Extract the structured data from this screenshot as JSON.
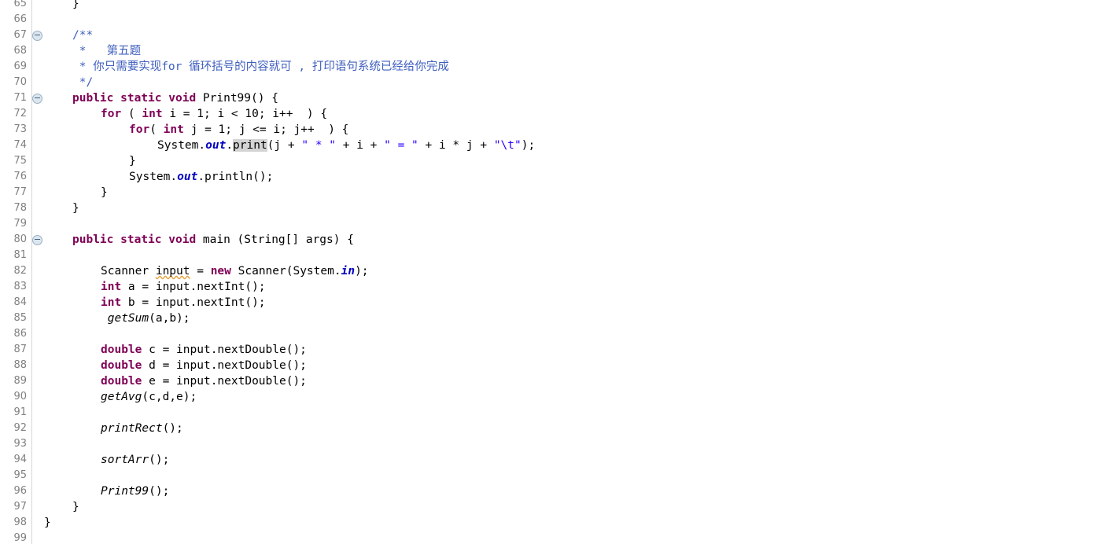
{
  "editor": {
    "kind": "java-source-editor",
    "language": "Java",
    "line_height": 20,
    "first_visible_line": 64,
    "last_visible_line": 99,
    "colors": {
      "background": "#ffffff",
      "keyword": "#7f0055",
      "string": "#2a00ff",
      "comment": "#3f5fbf",
      "javadoc_tag": "#7f9fbf",
      "static_field": "#0000c0",
      "line_number": "#808080",
      "occurrence_highlight": "#d4d4d4",
      "warning_underline": "#e8a33d",
      "warning_marker": "#f5b60d",
      "gutter_separator": "#d6d6d6"
    }
  },
  "gutter": {
    "line_numbers": [
      65,
      66,
      67,
      68,
      69,
      70,
      71,
      72,
      73,
      74,
      75,
      76,
      77,
      78,
      79,
      80,
      81,
      82,
      83,
      84,
      85,
      86,
      87,
      88,
      89,
      90,
      91,
      92,
      93,
      94,
      95,
      96,
      97,
      98
    ],
    "fold_markers": {
      "label": "collapse-fold-icon",
      "lines": [
        67,
        71,
        80
      ]
    },
    "warning_markers": {
      "label": "warning-marker-icon",
      "lines": [
        82
      ]
    }
  },
  "code": {
    "lines": [
      {
        "num": 65,
        "indent": 1,
        "text": "}"
      },
      {
        "num": 66,
        "indent": 0,
        "text": ""
      },
      {
        "num": 67,
        "indent": 1,
        "text": "/**"
      },
      {
        "num": 68,
        "indent": 1,
        "text": " *   第五题"
      },
      {
        "num": 69,
        "indent": 1,
        "text": " * 你只需要实现for 循环括号的内容就可 , 打印语句系统已经给你完成"
      },
      {
        "num": 70,
        "indent": 1,
        "text": " */"
      },
      {
        "num": 71,
        "indent": 1,
        "text": "public static void Print99() {"
      },
      {
        "num": 72,
        "indent": 2,
        "text": "for ( int i = 1; i < 10; i++  ) {"
      },
      {
        "num": 73,
        "indent": 3,
        "text": "for( int j = 1; j <= i; j++  ) {"
      },
      {
        "num": 74,
        "indent": 4,
        "text": "System.out.print(j + \" * \" + i + \" = \" + i * j + \"\\t\");"
      },
      {
        "num": 75,
        "indent": 3,
        "text": "}"
      },
      {
        "num": 76,
        "indent": 3,
        "text": "System.out.println();"
      },
      {
        "num": 77,
        "indent": 2,
        "text": "}"
      },
      {
        "num": 78,
        "indent": 1,
        "text": "}"
      },
      {
        "num": 79,
        "indent": 0,
        "text": ""
      },
      {
        "num": 80,
        "indent": 1,
        "text": "public static void main (String[] args) {"
      },
      {
        "num": 81,
        "indent": 0,
        "text": ""
      },
      {
        "num": 82,
        "indent": 2,
        "text": "Scanner input = new Scanner(System.in);"
      },
      {
        "num": 83,
        "indent": 2,
        "text": "int a = input.nextInt();"
      },
      {
        "num": 84,
        "indent": 2,
        "text": "int b = input.nextInt();"
      },
      {
        "num": 85,
        "indent": 2,
        "text": " getSum(a,b);"
      },
      {
        "num": 86,
        "indent": 0,
        "text": ""
      },
      {
        "num": 87,
        "indent": 2,
        "text": "double c = input.nextDouble();"
      },
      {
        "num": 88,
        "indent": 2,
        "text": "double d = input.nextDouble();"
      },
      {
        "num": 89,
        "indent": 2,
        "text": "double e = input.nextDouble();"
      },
      {
        "num": 90,
        "indent": 2,
        "text": "getAvg(c,d,e);"
      },
      {
        "num": 91,
        "indent": 0,
        "text": ""
      },
      {
        "num": 92,
        "indent": 2,
        "text": "printRect();"
      },
      {
        "num": 93,
        "indent": 0,
        "text": ""
      },
      {
        "num": 94,
        "indent": 2,
        "text": "sortArr();"
      },
      {
        "num": 95,
        "indent": 0,
        "text": ""
      },
      {
        "num": 96,
        "indent": 2,
        "text": "Print99();"
      },
      {
        "num": 97,
        "indent": 1,
        "text": "}"
      },
      {
        "num": 98,
        "indent": 0,
        "text": "}"
      }
    ],
    "comment_block": {
      "title": "第五题",
      "body": "你只需要实现for 循环括号的内容就可 , 打印语句系统已经给你完成"
    },
    "highlighted_token": "print",
    "warning_token": "input",
    "methods": [
      "Print99",
      "main",
      "getSum",
      "getAvg",
      "printRect",
      "sortArr"
    ],
    "keywords": [
      "public",
      "static",
      "void",
      "for",
      "int",
      "new",
      "double"
    ],
    "strings": [
      "\" * \"",
      "\" = \"",
      "\"\\t\""
    ]
  }
}
